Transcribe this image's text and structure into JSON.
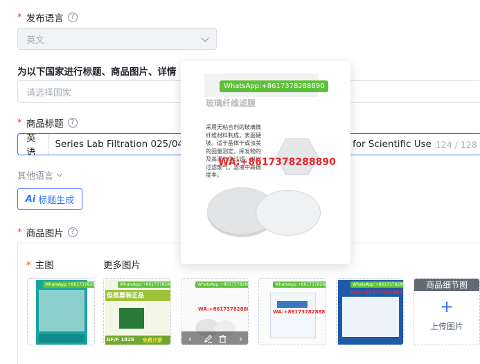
{
  "publish_language": {
    "required": "*",
    "label": "发布语言",
    "help": "?",
    "value": "英文"
  },
  "country_section": {
    "label": "为以下国家进行标题、商品图片、详情",
    "placeholder": "请选择国家"
  },
  "product_title": {
    "required": "*",
    "label": "商品标题",
    "help": "?",
    "lang_tag": "英语",
    "value_left": "Series Lab Filtration 025/04",
    "value_right": "for Scientific Use",
    "counter": "124 / 128"
  },
  "other_language": {
    "label": "其他语言"
  },
  "title_generate": {
    "icon": "Ai",
    "label": "标题生成"
  },
  "product_images": {
    "required": "*",
    "label": "商品图片",
    "help": "?",
    "main_required": "*",
    "main_label": "主图",
    "more_label": "更多图片",
    "detail_label": "商品细节图",
    "upload_label": "上传图片",
    "plus": "+"
  },
  "popup": {
    "whatsapp_tag": "WhatsApp:+8617378288890",
    "wa_overlay": "WA:+8617378288890",
    "desc": "采用无粘合剂的玻璃微纤维材料制成，表面硬坡。适于晶体干或浊美的固量测定，挥发物的及高温气体过滤。可以过滤废气，滤液中高微度率。",
    "heading": "玻璃纤维滤膜"
  },
  "thumbs": {
    "t1_tag": "WhatsApp:+8617378288890",
    "t2_tag": "WhatsApp:+8617378288890",
    "t2_banner": "但是票装正品",
    "t2_bottom_left": "GF/F 1825",
    "t2_bottom_right": "免费开票",
    "t3_tag": "WhatsApp:+8617378288890",
    "t3_wa": "WA:+8617378288890",
    "t4_tag": "WhatsApp:+8617378288890",
    "t4_wa": "WA:+8617378288890",
    "t5_tag": "WhatsApp:+8617378288890",
    "t5_wa": "WA:+8617378288890"
  },
  "colors": {
    "accent": "#3370ff",
    "required": "#f53f3f",
    "wa_green": "#5fbf3a",
    "wa_red": "#e8262b"
  }
}
